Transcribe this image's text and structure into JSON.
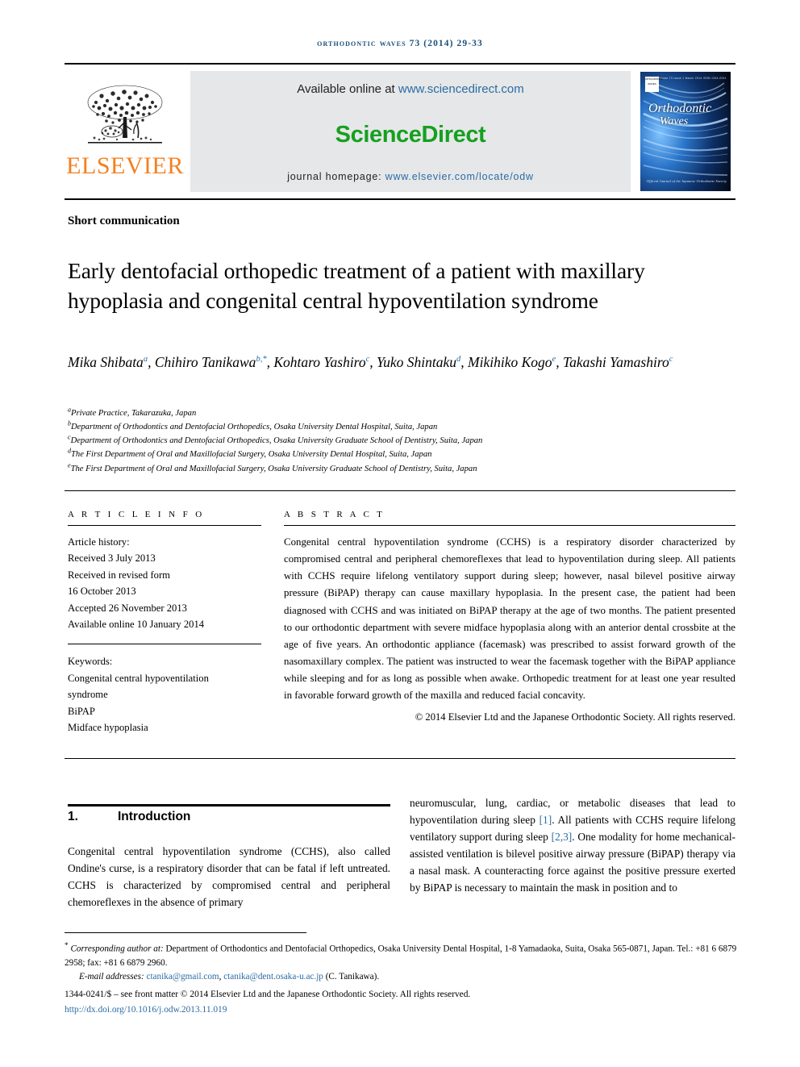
{
  "running_head": "Orthodontic Waves 73 (2014) 29-33",
  "masthead": {
    "publisher_name": "ELSEVIER",
    "available_prefix": "Available online at ",
    "available_link": "www.sciencedirect.com",
    "sciencedirect_logo": "ScienceDirect",
    "homepage_prefix": "journal homepage: ",
    "homepage_link": "www.elsevier.com/locate/odw",
    "cover": {
      "title_line1": "Orthodontic",
      "title_line2": "Waves",
      "top_line": "Volume 73  Issue 1  March 2014  ISSN 1344-0241",
      "bottom_line": "Official Journal of the Japanese Orthodontic Society",
      "mark_line1": "ORTHODONTIC",
      "mark_line2": "WAVES",
      "accent_color": "#1f6fc4"
    },
    "brand_color": "#F48020",
    "sciencedirect_color": "#15a01f",
    "link_color": "#2b6ca3"
  },
  "article": {
    "type": "Short communication",
    "title": "Early dentofacial orthopedic treatment of a patient with maxillary hypoplasia and congenital central hypoventilation syndrome",
    "authors": [
      {
        "name": "Mika Shibata",
        "sup": "a",
        "sep": ", "
      },
      {
        "name": "Chihiro Tanikawa",
        "sup": "b,*",
        "sep": ", "
      },
      {
        "name": "Kohtaro Yashiro",
        "sup": "c",
        "sep": ", "
      },
      {
        "name": "Yuko Shintaku",
        "sup": "d",
        "sep": ", "
      },
      {
        "name": "Mikihiko Kogo",
        "sup": "e",
        "sep": ", "
      },
      {
        "name": "Takashi Yamashiro",
        "sup": "c",
        "sep": ""
      }
    ],
    "affiliations": [
      {
        "label": "a",
        "text": "Private Practice, Takarazuka, Japan"
      },
      {
        "label": "b",
        "text": "Department of Orthodontics and Dentofacial Orthopedics, Osaka University Dental Hospital, Suita, Japan"
      },
      {
        "label": "c",
        "text": "Department of Orthodontics and Dentofacial Orthopedics, Osaka University Graduate School of Dentistry, Suita, Japan"
      },
      {
        "label": "d",
        "text": "The First Department of Oral and Maxillofacial Surgery, Osaka University Dental Hospital, Suita, Japan"
      },
      {
        "label": "e",
        "text": "The First Department of Oral and Maxillofacial Surgery, Osaka University Graduate School of Dentistry, Suita, Japan"
      }
    ]
  },
  "article_info": {
    "section_label": "A R T I C L E   I N F O",
    "history_label": "Article history:",
    "history": [
      "Received 3 July 2013",
      "Received in revised form",
      "16 October 2013",
      "Accepted 26 November 2013",
      "Available online 10 January 2014"
    ],
    "keywords_label": "Keywords:",
    "keywords": [
      "Congenital central hypoventilation",
      "syndrome",
      "BiPAP",
      "Midface hypoplasia"
    ]
  },
  "abstract": {
    "section_label": "A B S T R A C T",
    "text": "Congenital central hypoventilation syndrome (CCHS) is a respiratory disorder characterized by compromised central and peripheral chemoreflexes that lead to hypoventilation during sleep. All patients with CCHS require lifelong ventilatory support during sleep; however, nasal bilevel positive airway pressure (BiPAP) therapy can cause maxillary hypoplasia. In the present case, the patient had been diagnosed with CCHS and was initiated on BiPAP therapy at the age of two months. The patient presented to our orthodontic department with severe midface hypoplasia along with an anterior dental crossbite at the age of five years. An orthodontic appliance (facemask) was prescribed to assist forward growth of the nasomaxillary complex. The patient was instructed to wear the facemask together with the BiPAP appliance while sleeping and for as long as possible when awake. Orthopedic treatment for at least one year resulted in favorable forward growth of the maxilla and reduced facial concavity.",
    "copyright": "© 2014 Elsevier Ltd and the Japanese Orthodontic Society. All rights reserved."
  },
  "body": {
    "section_number": "1.",
    "section_title": "Introduction",
    "left_column": "Congenital central hypoventilation syndrome (CCHS), also called Ondine's curse, is a respiratory disorder that can be fatal if left untreated. CCHS is characterized by compromised central and peripheral chemoreflexes in the absence of primary",
    "right_column_parts": [
      {
        "type": "text",
        "value": "neuromuscular, lung, cardiac, or metabolic diseases that lead to hypoventilation during sleep "
      },
      {
        "type": "cite",
        "value": "[1]"
      },
      {
        "type": "text",
        "value": ". All patients with CCHS require lifelong ventilatory support during sleep "
      },
      {
        "type": "cite",
        "value": "[2,3]"
      },
      {
        "type": "text",
        "value": ". One modality for home mechanical-assisted ventilation is bilevel positive airway pressure (BiPAP) therapy via a nasal mask. A counteracting force against the positive pressure exerted by BiPAP is necessary to maintain the mask in position and to"
      }
    ]
  },
  "footnote": {
    "corresponding_marker": "*",
    "corresponding_label": "Corresponding author at:",
    "corresponding_address": " Department of Orthodontics and Dentofacial Orthopedics, Osaka University Dental Hospital, 1-8 Yamadaoka, Suita, Osaka 565-0871, Japan. Tel.: +81 6 6879 2958; fax: +81 6 6879 2960.",
    "email_label": "E-mail addresses:",
    "email1": "ctanika@gmail.com",
    "email_sep": ", ",
    "email2": "ctanika@dent.osaka-u.ac.jp",
    "email_suffix": " (C. Tanikawa).",
    "front_matter": "1344-0241/$ – see front matter © 2014 Elsevier Ltd and the Japanese Orthodontic Society. All rights reserved.",
    "doi": "http://dx.doi.org/10.1016/j.odw.2013.11.019"
  }
}
